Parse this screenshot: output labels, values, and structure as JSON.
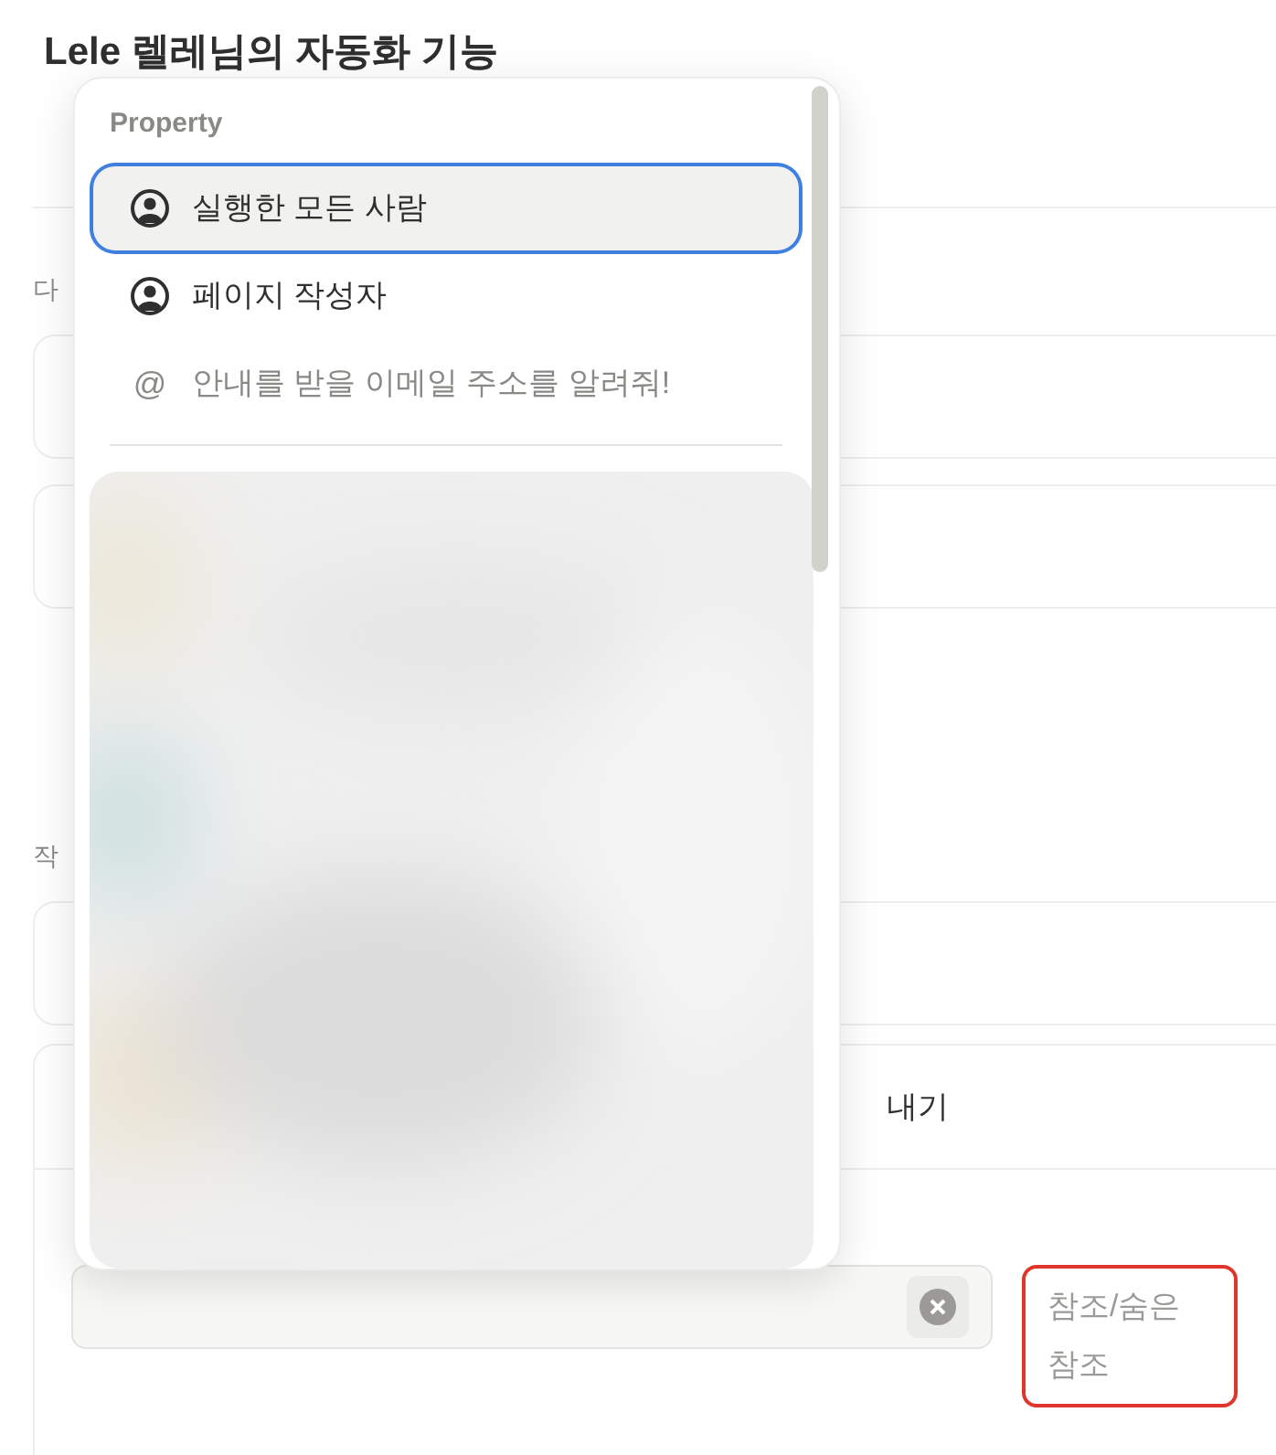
{
  "page": {
    "title": "Lele 렐레님의 자동화 기능",
    "section_label_1": "다",
    "section_label_2": "작",
    "send_row_text": "내기"
  },
  "recipient": {
    "cc_button": "참조/숨은 참조"
  },
  "popup": {
    "heading": "Property",
    "items": [
      {
        "kind": "person",
        "label": "실행한 모든 사람",
        "selected": true
      },
      {
        "kind": "person",
        "label": "페이지 작성자",
        "selected": false
      },
      {
        "kind": "email",
        "icon": "@",
        "label": "안내를 받을 이메일 주소를 알려줘!",
        "selected": false
      }
    ]
  }
}
